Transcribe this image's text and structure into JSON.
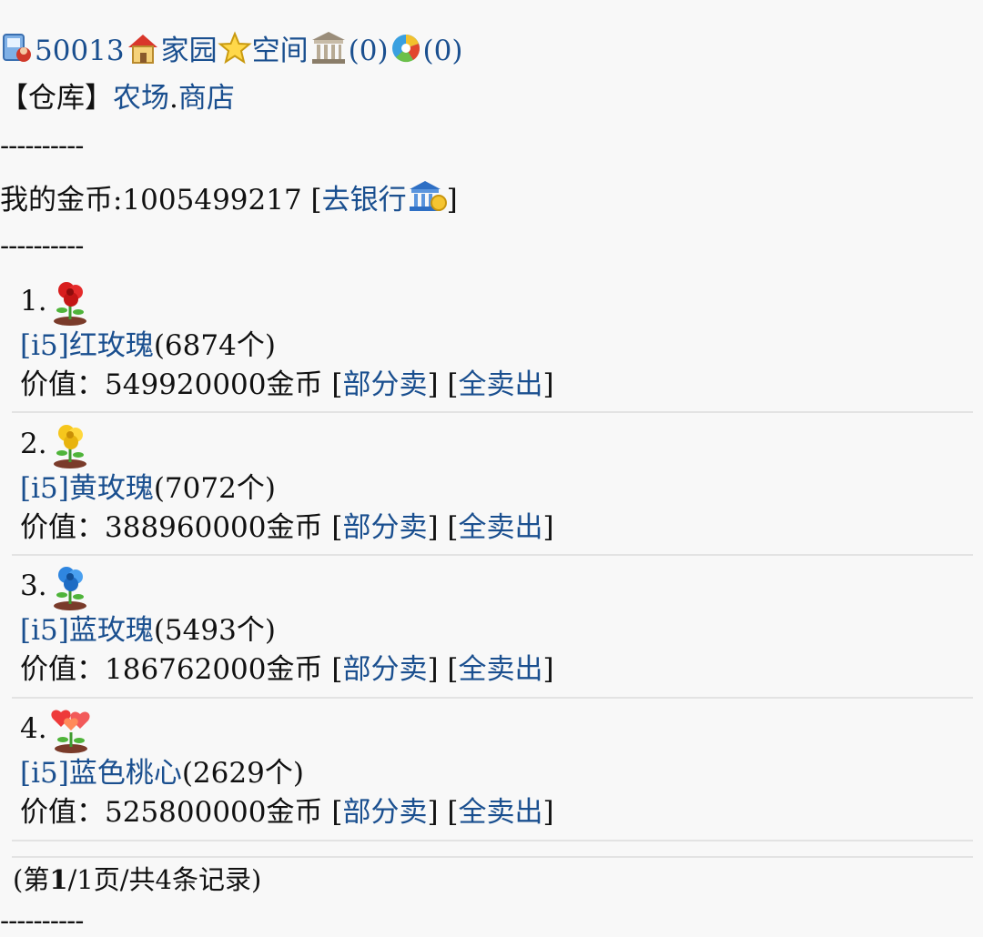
{
  "nav": {
    "user_id": "50013",
    "home_label": "家园",
    "space_label": "空间",
    "bank_count": "(0)",
    "wheel_count": "(0)"
  },
  "breadcrumb": {
    "warehouse": "【仓库】",
    "farm": "农场",
    "dot": ".",
    "shop": "商店"
  },
  "divider": "----------",
  "gold": {
    "label": "我的金币:",
    "amount": "1005499217",
    "bank_prefix": " [",
    "bank_link": "去银行",
    "bank_suffix": "]"
  },
  "items": [
    {
      "index": "1.",
      "tag": "[i5]",
      "name": "红玫瑰",
      "count": "(6874个)",
      "value_label": "价值：",
      "value": "549920000金币",
      "partial_sell": "部分卖",
      "sell_all": "全卖出",
      "icon": "red-rose-icon"
    },
    {
      "index": "2.",
      "tag": "[i5]",
      "name": "黄玫瑰",
      "count": "(7072个)",
      "value_label": "价值：",
      "value": "388960000金币",
      "partial_sell": "部分卖",
      "sell_all": "全卖出",
      "icon": "yellow-rose-icon"
    },
    {
      "index": "3.",
      "tag": "[i5]",
      "name": "蓝玫瑰",
      "count": "(5493个)",
      "value_label": "价值：",
      "value": "186762000金币",
      "partial_sell": "部分卖",
      "sell_all": "全卖出",
      "icon": "blue-rose-icon"
    },
    {
      "index": "4.",
      "tag": "[i5]",
      "name": "蓝色桃心",
      "count": "(2629个)",
      "value_label": "价值：",
      "value": "525800000金币",
      "partial_sell": "部分卖",
      "sell_all": "全卖出",
      "icon": "heart-flower-icon"
    }
  ],
  "pagination": {
    "prefix": "(第",
    "current": "1",
    "suffix": "/1页/共4条记录)"
  },
  "colors": {
    "link": "#1a4f8f",
    "background": "#f8f8f8",
    "separator": "#e3e3e3"
  }
}
